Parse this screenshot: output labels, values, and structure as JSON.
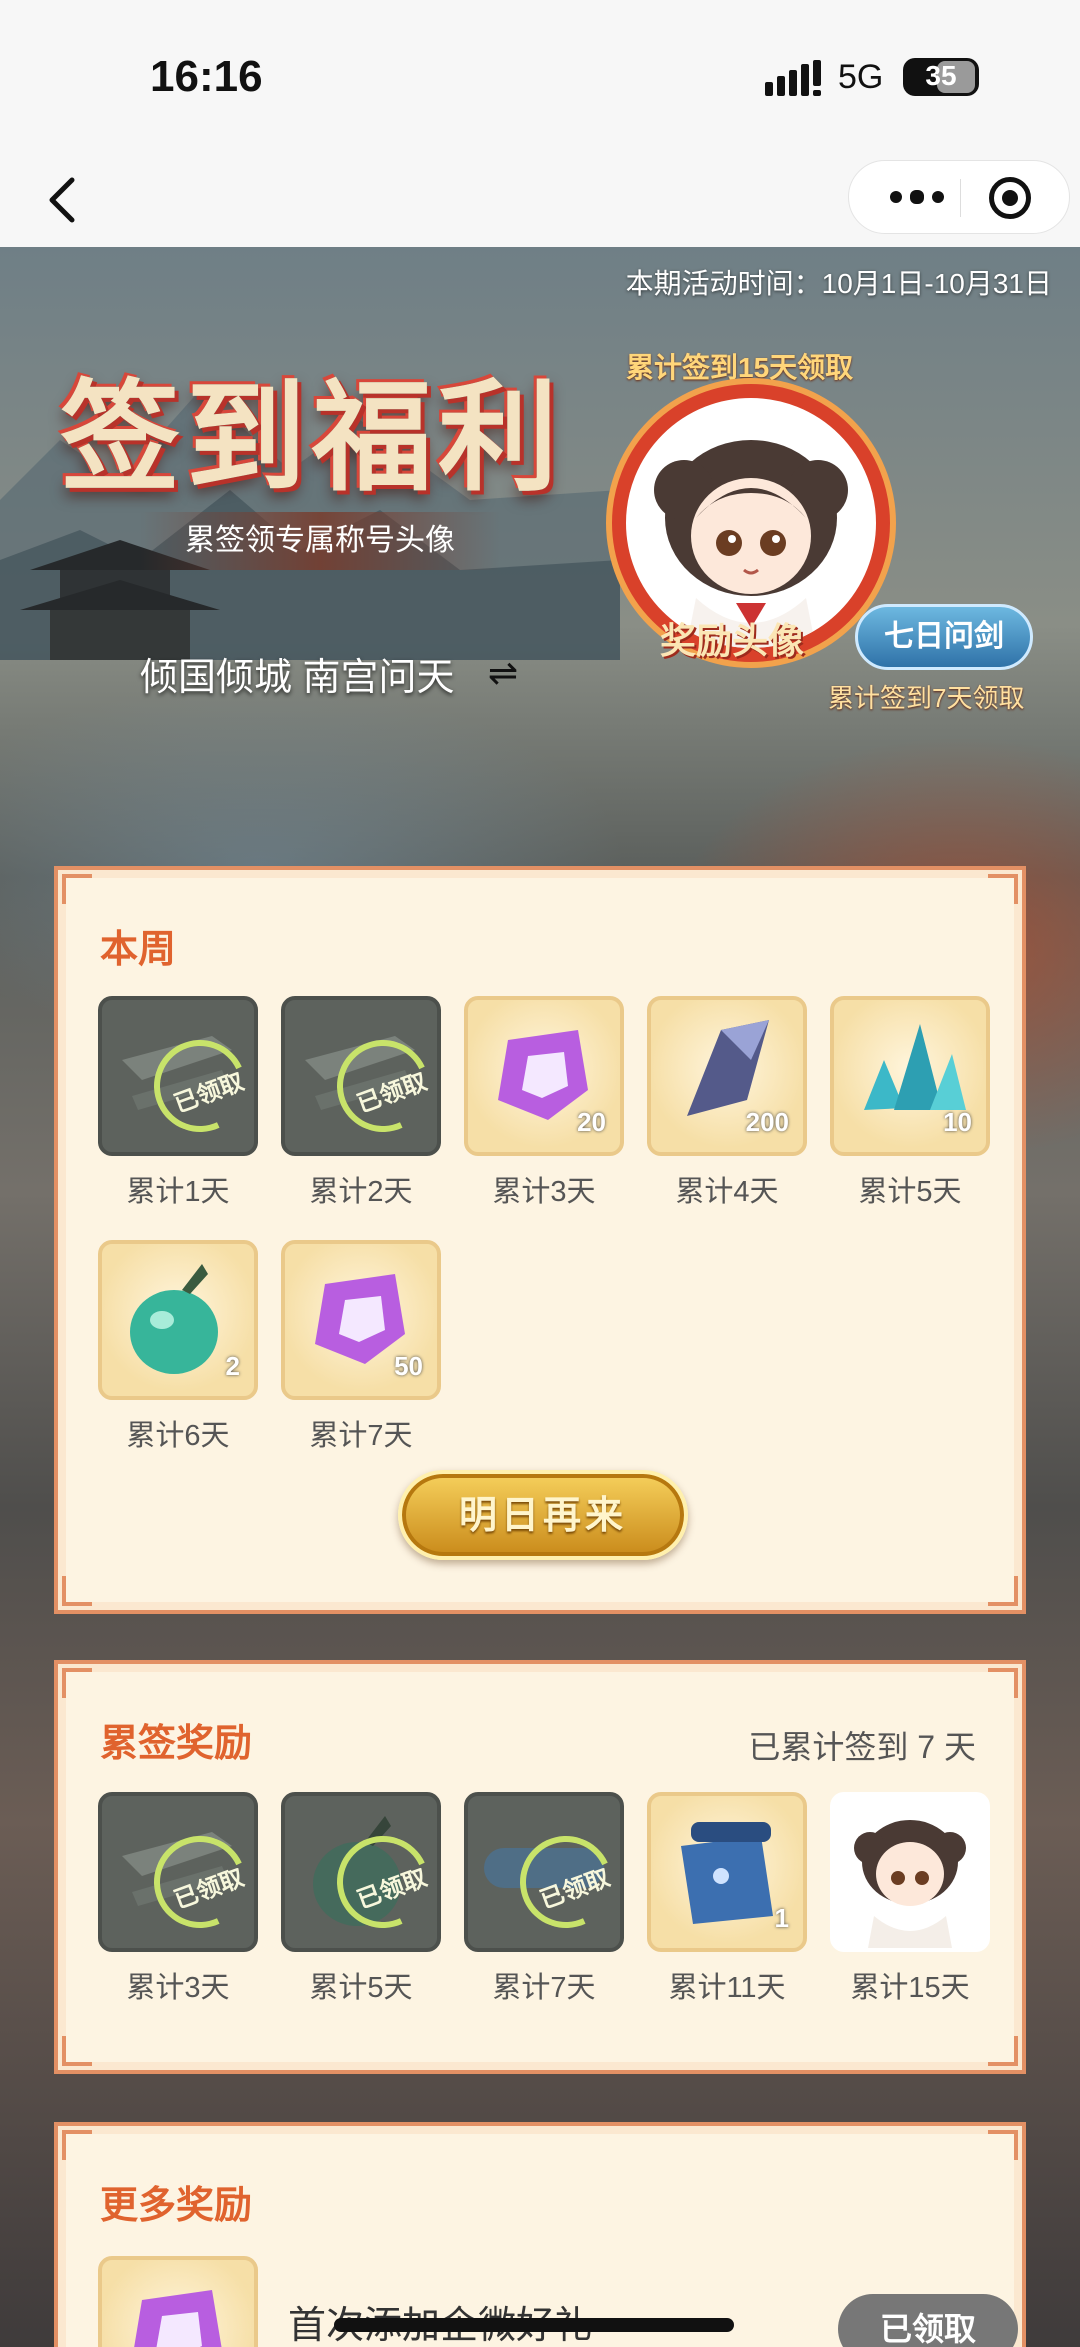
{
  "status_bar": {
    "time": "16:16",
    "network": "5G",
    "battery": "35"
  },
  "header": {
    "period": "本期活动时间：10月1日-10月31日"
  },
  "banner": {
    "title": "签到福利",
    "subtitle": "累签领专属称号头像",
    "nickname": "倾国倾城 南宫问天",
    "swap_symbol": "⇌",
    "avatar_tip": "累计签到15天领取",
    "avatar_label": "奖励头像",
    "title_badge": "七日问剑",
    "badge_tip": "累计签到7天领取"
  },
  "weekly": {
    "title": "本周",
    "items": [
      {
        "day": "累计1天",
        "state": "claimed",
        "claimed_label": "已领取",
        "icon": "sword-item-icon"
      },
      {
        "day": "累计2天",
        "state": "claimed",
        "claimed_label": "已领取",
        "icon": "sword-item-icon"
      },
      {
        "day": "累计3天",
        "state": "available",
        "qty": "20",
        "icon": "purple-gem-icon"
      },
      {
        "day": "累计4天",
        "state": "available",
        "qty": "200",
        "icon": "dark-crystal-icon"
      },
      {
        "day": "累计5天",
        "state": "available",
        "qty": "10",
        "icon": "teal-crystal-icon"
      },
      {
        "day": "累计6天",
        "state": "available",
        "qty": "2",
        "icon": "green-gourd-icon"
      },
      {
        "day": "累计7天",
        "state": "available",
        "qty": "50",
        "icon": "purple-gem-icon"
      }
    ],
    "button": "明日再来"
  },
  "cumulative": {
    "title": "累签奖励",
    "meta": "已累计签到 7 天",
    "items": [
      {
        "day": "累计3天",
        "state": "claimed",
        "claimed_label": "已领取",
        "icon": "sword-item-icon"
      },
      {
        "day": "累计5天",
        "state": "claimed",
        "claimed_label": "已领取",
        "icon": "green-gourd-icon"
      },
      {
        "day": "累计7天",
        "state": "claimed",
        "claimed_label": "已领取",
        "icon": "title-badge-icon"
      },
      {
        "day": "累计11天",
        "state": "available",
        "qty": "1",
        "icon": "blue-scroll-icon"
      },
      {
        "day": "累计15天",
        "state": "avatar",
        "icon": "avatar-icon"
      }
    ]
  },
  "more": {
    "title": "更多奖励",
    "item_text": "首次添加企微好礼",
    "button": "已领取"
  },
  "colors": {
    "accent": "#e0632e",
    "card_bg": "#fdf4e2",
    "card_border": "#e39064"
  }
}
